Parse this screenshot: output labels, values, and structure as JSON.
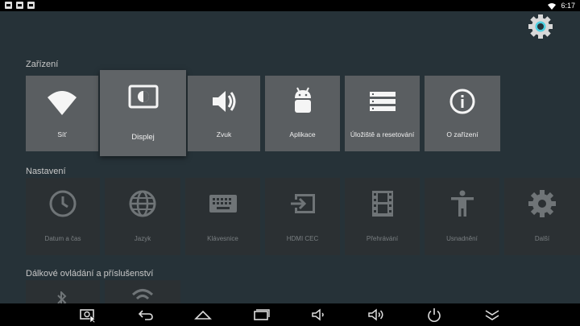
{
  "status": {
    "time": "6:17"
  },
  "sections": {
    "device": "Zařízení",
    "settings": "Nastavení",
    "remote": "Dálkové ovládání a příslušenství"
  },
  "device_tiles": [
    {
      "label": "Síť",
      "icon": "wifi-icon"
    },
    {
      "label": "Displej",
      "icon": "display-icon"
    },
    {
      "label": "Zvuk",
      "icon": "volume-icon"
    },
    {
      "label": "Aplikace",
      "icon": "android-icon"
    },
    {
      "label": "Úložiště a resetování",
      "icon": "storage-icon"
    },
    {
      "label": "O zařízení",
      "icon": "info-icon"
    }
  ],
  "settings_tiles": [
    {
      "label": "Datum a čas",
      "icon": "clock-icon"
    },
    {
      "label": "Jazyk",
      "icon": "globe-icon"
    },
    {
      "label": "Klávesnice",
      "icon": "keyboard-icon"
    },
    {
      "label": "HDMI CEC",
      "icon": "input-icon"
    },
    {
      "label": "Přehrávání",
      "icon": "film-icon"
    },
    {
      "label": "Usnadnění",
      "icon": "accessibility-icon"
    },
    {
      "label": "Další",
      "icon": "gear-icon"
    }
  ],
  "colors": {
    "background": "#263238",
    "tile": "#5a5e61",
    "tile_dim": "#2b3033",
    "accent": "#4dd0e1"
  }
}
